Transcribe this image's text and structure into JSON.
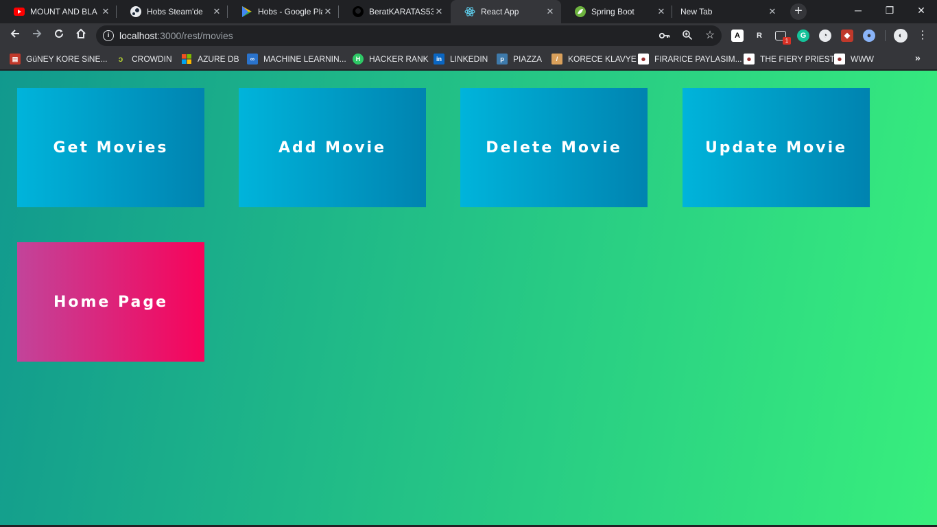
{
  "browser": {
    "tabs": [
      {
        "title": "MOUNT AND BLA",
        "icon": "youtube-icon",
        "color": "#ff0000"
      },
      {
        "title": "Hobs Steam'de",
        "icon": "steam-icon",
        "color": "#1b2838"
      },
      {
        "title": "Hobs - Google Pla",
        "icon": "google-play-icon",
        "color": "#34a853"
      },
      {
        "title": "BeratKARATAS53/",
        "icon": "github-icon",
        "color": "#ffffff"
      },
      {
        "title": "React App",
        "icon": "react-icon",
        "color": "#61dafb",
        "active": true
      },
      {
        "title": "Spring Boot",
        "icon": "spring-icon",
        "color": "#6db33f"
      },
      {
        "title": "New Tab",
        "icon": "",
        "color": ""
      }
    ],
    "url": {
      "host": "localhost",
      "path": ":3000/rest/movies"
    },
    "extension_badge": "1",
    "bookmarks": [
      {
        "label": "GüNEY KORE SiNE...",
        "icon": "film-icon",
        "color": "#c0392b"
      },
      {
        "label": "CROWDIN",
        "icon": "crowdin-icon",
        "color": "#2c2c2c"
      },
      {
        "label": "AZURE DB",
        "icon": "microsoft-icon",
        "color": "#f25022"
      },
      {
        "label": "MACHINE LEARNIN...",
        "icon": "coursera-icon",
        "color": "#2a73cc"
      },
      {
        "label": "HACKER RANK",
        "icon": "hackerrank-icon",
        "color": "#2ec866"
      },
      {
        "label": "LINKEDIN",
        "icon": "linkedin-icon",
        "color": "#0a66c2"
      },
      {
        "label": "PIAZZA",
        "icon": "piazza-icon",
        "color": "#3e7aab"
      },
      {
        "label": "KORECE KLAVYE",
        "icon": "keyboard-icon",
        "color": "#d9a05b"
      },
      {
        "label": "FIRARICE PAYLASIM...",
        "icon": "avatar-icon",
        "color": "#ffffff"
      },
      {
        "label": "THE FIERY PRIEST",
        "icon": "avatar-icon",
        "color": "#ffffff"
      },
      {
        "label": "WWW",
        "icon": "avatar-icon",
        "color": "#ffffff"
      }
    ]
  },
  "app": {
    "buttons": {
      "get_movies": "Get Movies",
      "add_movie": "Add Movie",
      "delete_movie": "Delete Movie",
      "update_movie": "Update Movie",
      "home_page": "Home Page"
    }
  }
}
